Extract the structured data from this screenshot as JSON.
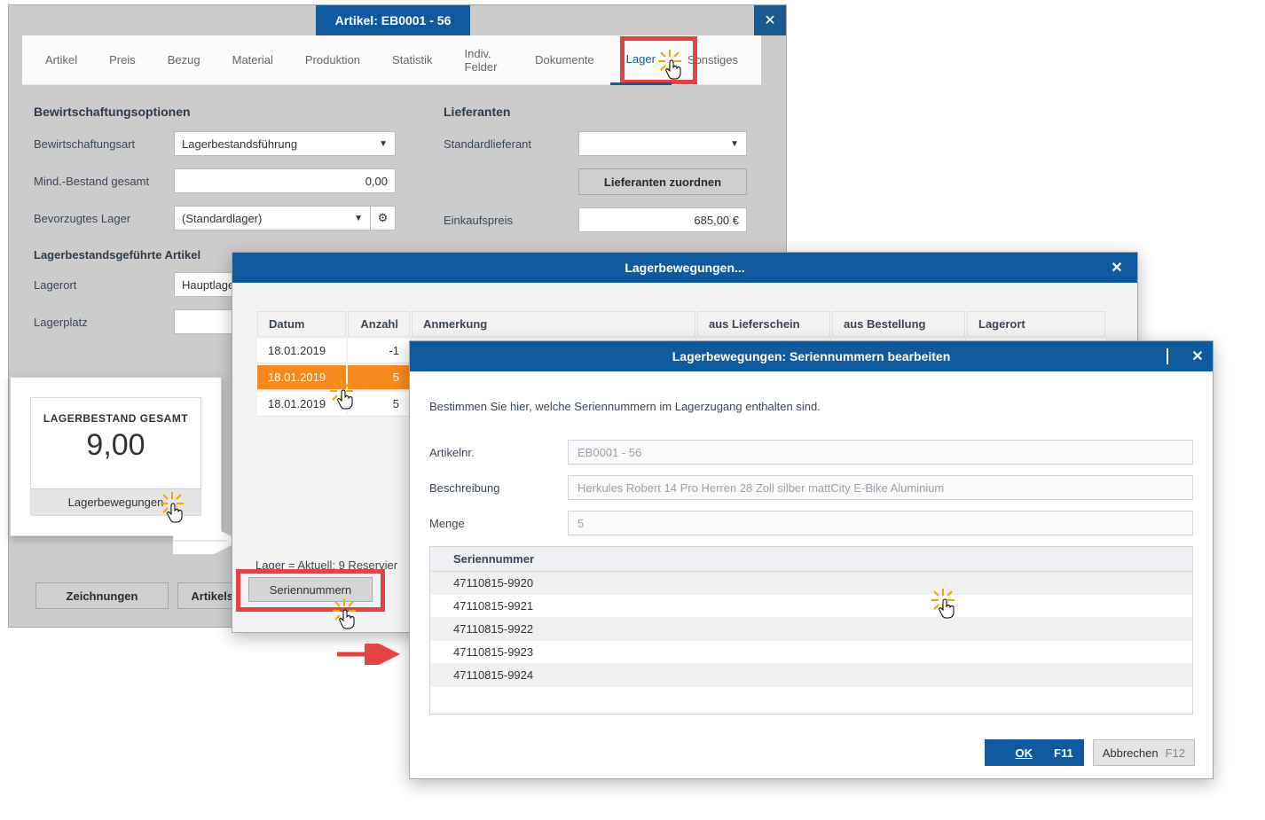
{
  "mainWindow": {
    "title": "Artikel: EB0001 - 56",
    "tabs": [
      "Artikel",
      "Preis",
      "Bezug",
      "Material",
      "Produktion",
      "Statistik",
      "Indiv. Felder",
      "Dokumente",
      "Lager",
      "Sonstiges"
    ],
    "activeTab": "Lager",
    "sections": {
      "bewirtschaftung": {
        "title": "Bewirtschaftungsoptionen",
        "art_label": "Bewirtschaftungsart",
        "art_value": "Lagerbestandsführung",
        "mind_label": "Mind.-Bestand gesamt",
        "mind_value": "0,00",
        "bevorzugt_label": "Bevorzugtes Lager",
        "bevorzugt_value": "(Standardlager)"
      },
      "lieferanten": {
        "title": "Lieferanten",
        "std_label": "Standardlieferant",
        "std_value": "",
        "zuordnen_btn": "Lieferanten zuordnen",
        "ek_label": "Einkaufspreis",
        "ek_value": "685,00 €"
      },
      "lagerbestand": {
        "title": "Lagerbestandsgeführte Artikel",
        "lagerort_label": "Lagerort",
        "lagerort_value": "Hauptlager",
        "lagerplatz_label": "Lagerplatz",
        "lagerplatz_value": ""
      }
    },
    "card": {
      "caption": "LAGERBESTAND GESAMT",
      "value": "9,00",
      "button": "Lagerbewegungen"
    },
    "bottomButtons": [
      "Zeichnungen",
      "Artikelsta"
    ]
  },
  "moveWindow": {
    "title": "Lagerbewegungen...",
    "columns": [
      "Datum",
      "Anzahl",
      "Anmerkung",
      "aus Lieferschein",
      "aus Bestellung",
      "Lagerort"
    ],
    "rows": [
      {
        "date": "18.01.2019",
        "qty": "-1"
      },
      {
        "date": "18.01.2019",
        "qty": "5",
        "selected": true
      },
      {
        "date": "18.01.2019",
        "qty": "5"
      }
    ],
    "status": "Lager = Aktuell: 9   Reservier",
    "serienBtn": "Seriennummern"
  },
  "serialWindow": {
    "title": "Lagerbewegungen: Seriennummern bearbeiten",
    "hint": "Bestimmen Sie hier, welche Seriennummern im Lagerzugang enthalten sind.",
    "fields": {
      "artnr_label": "Artikelnr.",
      "artnr_value": "EB0001 - 56",
      "beschr_label": "Beschreibung",
      "beschr_value": "Herkules Robert 14 Pro Herren 28 Zoll silber mattCity E-Bike Aluminium",
      "menge_label": "Menge",
      "menge_value": "5"
    },
    "gridHeader": "Seriennummer",
    "serials": [
      "47110815-9920",
      "47110815-9921",
      "47110815-9922",
      "47110815-9923",
      "47110815-9924"
    ],
    "ok": "OK",
    "okHotkey": "F11",
    "cancel": "Abbrechen",
    "cancelHotkey": "F12"
  }
}
